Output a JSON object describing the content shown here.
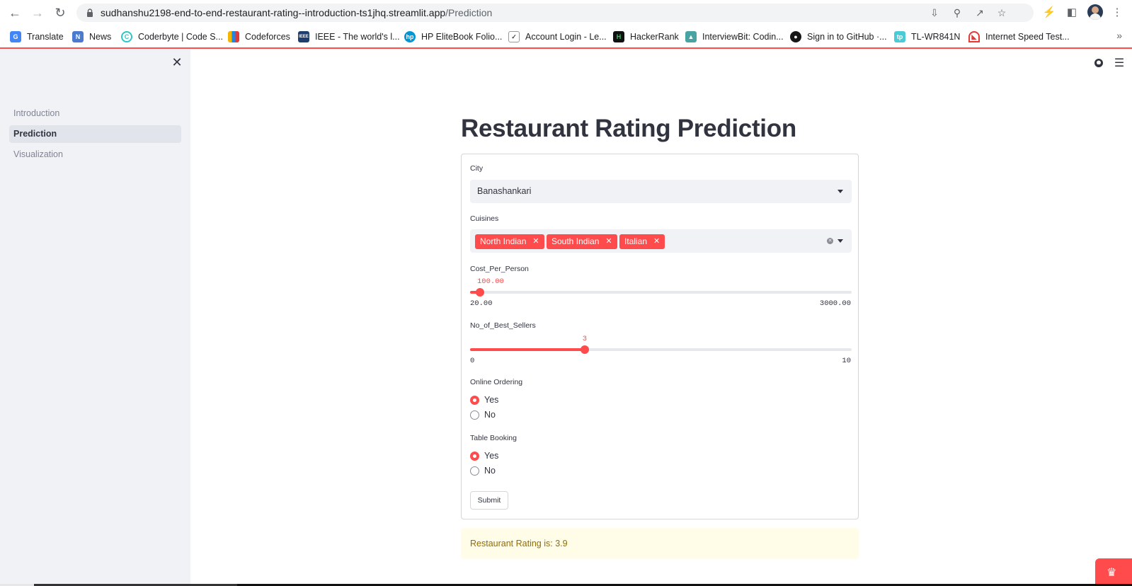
{
  "browser": {
    "url_host": "sudhanshu2198-end-to-end-restaurant-rating--introduction-ts1jhq.streamlit.app",
    "url_path": "/Prediction",
    "bookmarks": [
      {
        "label": "Translate",
        "icon": "google-translate-icon",
        "color": "#4285f4"
      },
      {
        "label": "News",
        "icon": "google-news-icon",
        "color": "#4a7bd0"
      },
      {
        "label": "Coderbyte | Code S...",
        "icon": "coderbyte-icon",
        "color": "#2ec5c6"
      },
      {
        "label": "Codeforces",
        "icon": "codeforces-icon",
        "color": "#f4b400"
      },
      {
        "label": "IEEE - The world's l...",
        "icon": "ieee-icon",
        "color": "#1d3e6e"
      },
      {
        "label": "HP EliteBook Folio...",
        "icon": "hp-icon",
        "color": "#0096d6"
      },
      {
        "label": "Account Login - Le...",
        "icon": "account-login-icon",
        "color": "#444444"
      },
      {
        "label": "HackerRank",
        "icon": "hackerrank-icon",
        "color": "#111111"
      },
      {
        "label": "InterviewBit: Codin...",
        "icon": "interviewbit-icon",
        "color": "#4aa3a3"
      },
      {
        "label": "Sign in to GitHub ·...",
        "icon": "github-icon",
        "color": "#181717"
      },
      {
        "label": "TL-WR841N",
        "icon": "tplink-icon",
        "color": "#4acbd6"
      },
      {
        "label": "Internet Speed Test...",
        "icon": "speedtest-icon",
        "color": "#e53935"
      }
    ],
    "more_label": "»"
  },
  "sidebar": {
    "items": [
      {
        "label": "Introduction"
      },
      {
        "label": "Prediction"
      },
      {
        "label": "Visualization"
      }
    ]
  },
  "main": {
    "title": "Restaurant Rating Prediction",
    "city": {
      "label": "City",
      "value": "Banashankari"
    },
    "cuisines": {
      "label": "Cuisines",
      "selected": [
        "North Indian",
        "South Indian",
        "Italian"
      ]
    },
    "cost": {
      "label": "Cost_Per_Person",
      "value": "100.00",
      "min": "20.00",
      "max": "3000.00",
      "fraction": 0.0268
    },
    "best_sellers": {
      "label": "No_of_Best_Sellers",
      "value": "3",
      "min": "0",
      "max": "10",
      "fraction": 0.3
    },
    "online_ordering": {
      "label": "Online Ordering",
      "options": [
        "Yes",
        "No"
      ],
      "selected": "Yes"
    },
    "table_booking": {
      "label": "Table Booking",
      "options": [
        "Yes",
        "No"
      ],
      "selected": "Yes"
    },
    "submit_label": "Submit",
    "result_text": "Restaurant Rating is: 3.9"
  },
  "colors": {
    "accent": "#ff4b4b",
    "sidebar_bg": "#f0f2f6",
    "result_bg": "#fffce7",
    "result_text": "#926c05"
  }
}
